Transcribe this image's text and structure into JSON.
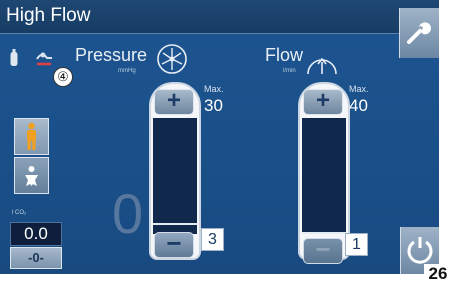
{
  "title": "High Flow",
  "pressure": {
    "label": "Pressure",
    "unit": "mmHg",
    "max_label": "Max.",
    "max_value": "30",
    "set_value": "3",
    "current_value": "0",
    "minus_enabled": true
  },
  "flow": {
    "label": "Flow",
    "unit": "l/min",
    "max_label": "Max.",
    "max_value": "40",
    "set_value": "1",
    "minus_enabled": false
  },
  "callout_number": "④",
  "co2": {
    "label": "l CO₂",
    "value": "0.0",
    "reset_label": "-0-"
  },
  "patient_modes": [
    {
      "name": "adult-mode",
      "active": true
    },
    {
      "name": "pediatric-mode",
      "active": false
    }
  ],
  "page_number": "26",
  "colors": {
    "screen_bg": "#1a4f88",
    "bar_fill": "#11284d",
    "patient_icon": "#f0a020",
    "warning_icon": "#e04040"
  }
}
